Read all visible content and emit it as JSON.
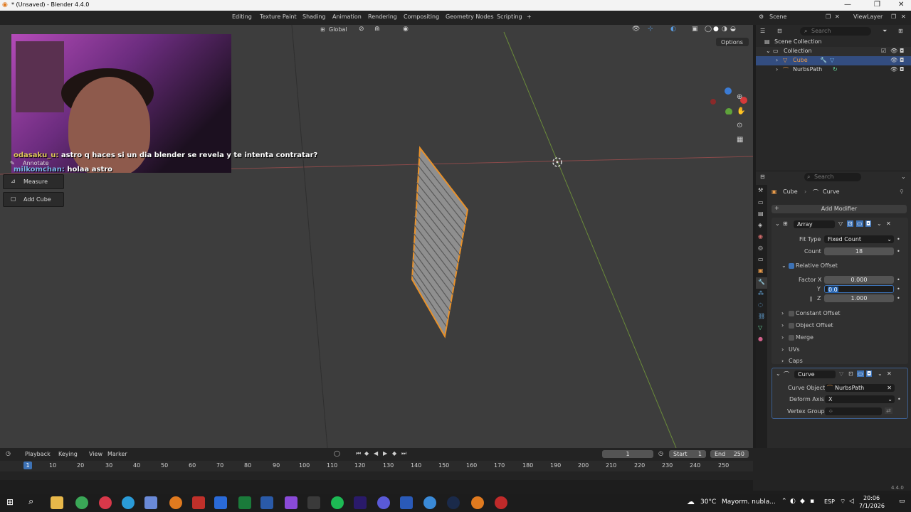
{
  "window": {
    "title": "* (Unsaved) - Blender 4.4.0"
  },
  "workspaces": [
    "Editing",
    "Texture Paint",
    "Shading",
    "Animation",
    "Rendering",
    "Compositing",
    "Geometry Nodes",
    "Scripting"
  ],
  "scene": {
    "name": "Scene",
    "view_layer": "ViewLayer"
  },
  "viewport": {
    "transform_orientation": "Global",
    "options_label": "Options"
  },
  "chat": [
    {
      "user": "odasaku_u:",
      "message": "astro q haces si un dia blender se revela y te intenta contratar?"
    },
    {
      "user": "milkomchan:",
      "message": "holaa astro"
    }
  ],
  "tools": {
    "annotate": "Annotate",
    "measure": "Measure",
    "add_cube": "Add Cube"
  },
  "outliner": {
    "search_placeholder": "Search",
    "scene_collection": "Scene Collection",
    "collection": "Collection",
    "items": [
      "Cube",
      "NurbsPath"
    ]
  },
  "properties": {
    "search_placeholder": "Search",
    "breadcrumb": {
      "object": "Cube",
      "modifier": "Curve"
    },
    "add_modifier": "Add Modifier",
    "array": {
      "name": "Array",
      "fit_type_label": "Fit Type",
      "fit_type_value": "Fixed Count",
      "count_label": "Count",
      "count_value": "18",
      "relative_offset_label": "Relative Offset",
      "factor_x_label": "Factor X",
      "factor_x_value": "0.000",
      "y_label": "Y",
      "y_value": "0.0",
      "z_label": "Z",
      "z_value": "1.000",
      "constant_offset": "Constant Offset",
      "object_offset": "Object Offset",
      "merge": "Merge",
      "uvs": "UVs",
      "caps": "Caps"
    },
    "curve": {
      "name": "Curve",
      "curve_object_label": "Curve Object",
      "curve_object_value": "NurbsPath",
      "deform_axis_label": "Deform Axis",
      "deform_axis_value": "X",
      "vertex_group_label": "Vertex Group"
    }
  },
  "timeline": {
    "menus": [
      "Playback",
      "Keying",
      "View",
      "Marker"
    ],
    "current_frame": "1",
    "start_label": "Start",
    "start_value": "1",
    "end_label": "End",
    "end_value": "250",
    "ticks": [
      "1",
      "10",
      "20",
      "30",
      "40",
      "50",
      "60",
      "70",
      "80",
      "90",
      "100",
      "110",
      "120",
      "130",
      "140",
      "150",
      "160",
      "170",
      "180",
      "190",
      "200",
      "210",
      "220",
      "230",
      "240",
      "250"
    ]
  },
  "status": {
    "version": "4.4.0"
  },
  "taskbar": {
    "weather": "30°C",
    "weather_desc": "Mayorm. nubla...",
    "lang": "ESP",
    "time": "20:06",
    "date": "7/1/2026"
  }
}
